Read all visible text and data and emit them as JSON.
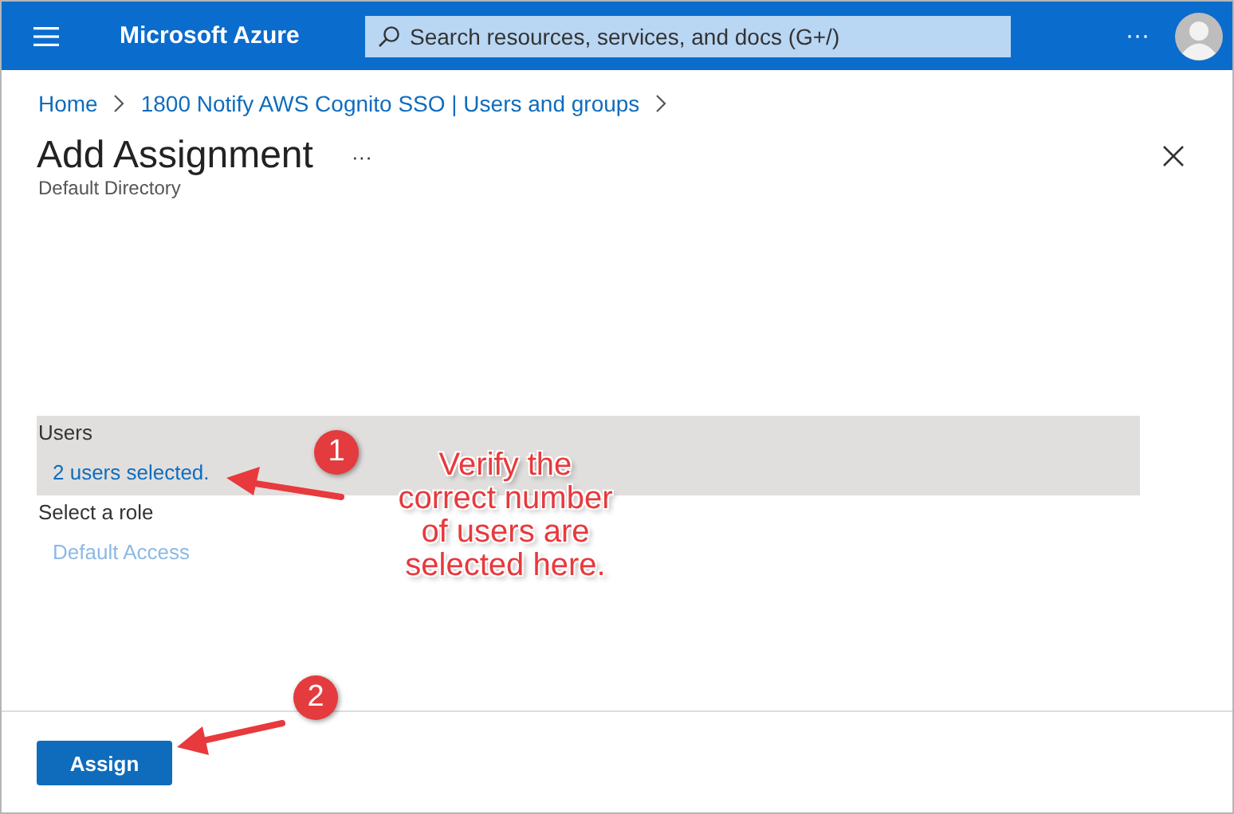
{
  "header": {
    "title": "Microsoft Azure",
    "search": {
      "placeholder": "Search resources, services, and docs (G+/)"
    },
    "more": "···"
  },
  "breadcrumb": [
    "Home",
    "1800 Notify AWS Cognito SSO | Users and groups"
  ],
  "panel": {
    "title": "Add Assignment",
    "more": "···",
    "subtitle": "Default Directory"
  },
  "fields": [
    {
      "label": "Users",
      "value": "2 users selected.",
      "highlighted": true,
      "disabled": false
    },
    {
      "label": "Select a role",
      "value": "Default Access",
      "highlighted": false,
      "disabled": true
    }
  ],
  "buttons": [
    {
      "label": "Assign"
    }
  ],
  "annotations": [
    {
      "number": "1",
      "text": "Verify the correct number of users are selected here."
    },
    {
      "number": "2"
    }
  ]
}
